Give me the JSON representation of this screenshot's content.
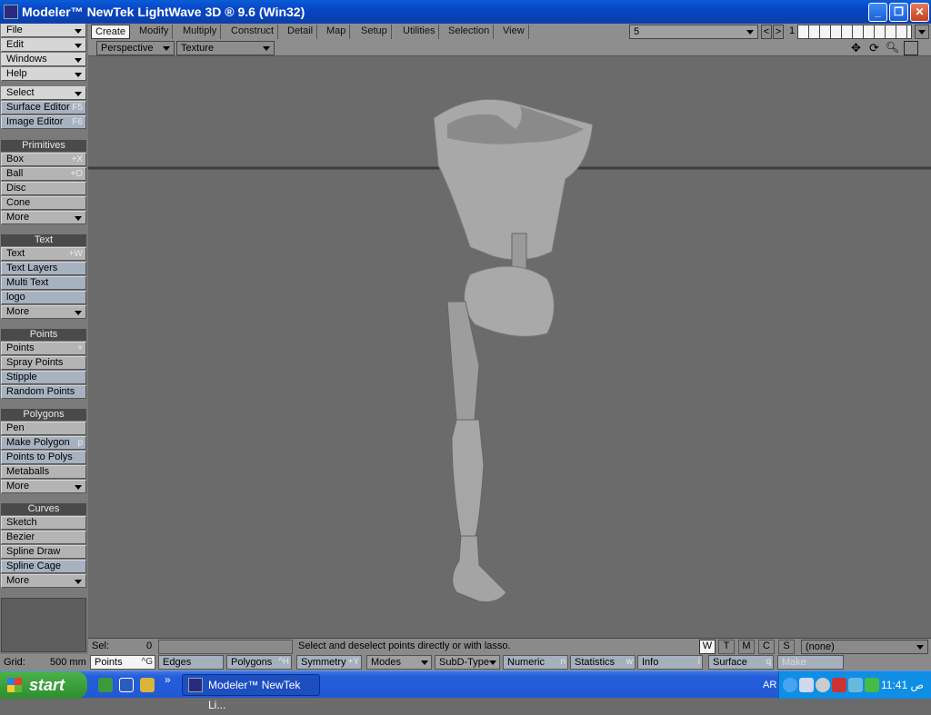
{
  "window": {
    "title": "Modeler™ NewTek LightWave 3D ® 9.6  (Win32)"
  },
  "menu_left": {
    "file": "File",
    "edit": "Edit",
    "windows": "Windows",
    "help": "Help",
    "select": "Select",
    "surface_editor": {
      "label": "Surface Editor",
      "shortcut": "F5"
    },
    "image_editor": {
      "label": "Image Editor",
      "shortcut": "F6"
    }
  },
  "primitives": {
    "header": "Primitives",
    "items": [
      {
        "label": "Box",
        "shortcut": "+X"
      },
      {
        "label": "Ball",
        "shortcut": "+O"
      },
      {
        "label": "Disc",
        "shortcut": ""
      },
      {
        "label": "Cone",
        "shortcut": ""
      },
      {
        "label": "More",
        "shortcut": ""
      }
    ]
  },
  "text": {
    "header": "Text",
    "items": [
      {
        "label": "Text",
        "shortcut": "+W"
      },
      {
        "label": "Text Layers",
        "shortcut": ""
      },
      {
        "label": "Multi Text",
        "shortcut": ""
      },
      {
        "label": "logo",
        "shortcut": ""
      },
      {
        "label": "More",
        "shortcut": ""
      }
    ]
  },
  "points": {
    "header": "Points",
    "items": [
      {
        "label": "Points",
        "shortcut": "+"
      },
      {
        "label": "Spray Points",
        "shortcut": ""
      },
      {
        "label": "Stipple",
        "shortcut": ""
      },
      {
        "label": "Random Points",
        "shortcut": ""
      }
    ]
  },
  "polygons": {
    "header": "Polygons",
    "items": [
      {
        "label": "Pen",
        "shortcut": ""
      },
      {
        "label": "Make Polygon",
        "shortcut": "p"
      },
      {
        "label": "Points to Polys",
        "shortcut": ""
      },
      {
        "label": "Metaballs",
        "shortcut": ""
      },
      {
        "label": "More",
        "shortcut": ""
      }
    ]
  },
  "curves": {
    "header": "Curves",
    "items": [
      {
        "label": "Sketch",
        "shortcut": ""
      },
      {
        "label": "Bezier",
        "shortcut": ""
      },
      {
        "label": "Spline Draw",
        "shortcut": ""
      },
      {
        "label": "Spline Cage",
        "shortcut": ""
      },
      {
        "label": "More",
        "shortcut": ""
      }
    ]
  },
  "tabs": [
    "Create",
    "Modify",
    "Multiply",
    "Construct",
    "Detail",
    "Map",
    "Setup",
    "Utilities",
    "Selection",
    "View"
  ],
  "layer_select": "5",
  "layer_number": "1",
  "view": {
    "mode": "Perspective",
    "shading": "Texture"
  },
  "status": {
    "sel_label": "Sel:",
    "sel_value": "0",
    "message": "Select and deselect points directly or with lasso.",
    "wtmcs": [
      "W",
      "T",
      "M",
      "C",
      "S"
    ],
    "surface_select": "(none)"
  },
  "bottom": {
    "grid_label": "Grid:",
    "grid_value": "500 mm",
    "points": "Points",
    "points_sc": "^G",
    "edges": "Edges",
    "polygons": "Polygons",
    "polygons_sc": "^H",
    "symmetry": "Symmetry",
    "symmetry_sc": "+Y",
    "modes": "Modes",
    "subd": "SubD-Type",
    "numeric": "Numeric",
    "numeric_sc": "n",
    "statistics": "Statistics",
    "statistics_sc": "w",
    "info": "Info",
    "info_sc": "i",
    "surface": "Surface",
    "surface_sc": "q",
    "make": "Make"
  },
  "taskbar": {
    "start": "start",
    "task": "Modeler™ NewTek Li...",
    "lang": "AR",
    "time": "11:41 ص"
  }
}
